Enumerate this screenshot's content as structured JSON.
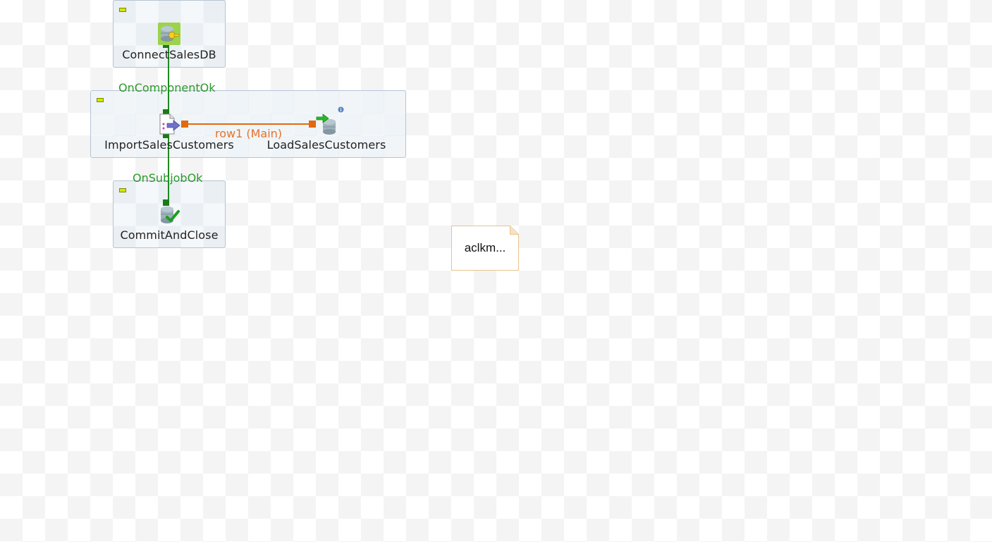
{
  "job": {
    "subjobs": [
      {
        "components": [
          {
            "label": "ConnectSalesDB",
            "icon": "database-connect-icon"
          }
        ]
      },
      {
        "components": [
          {
            "label": "ImportSalesCustomers",
            "icon": "file-input-icon"
          },
          {
            "label": "LoadSalesCustomers",
            "icon": "database-output-icon"
          }
        ]
      },
      {
        "components": [
          {
            "label": "CommitAndClose",
            "icon": "database-commit-icon"
          }
        ]
      }
    ],
    "links": [
      {
        "label": "OnComponentOk",
        "color": "#2a9a2a"
      },
      {
        "label": "row1 (Main)",
        "color": "#e3742c"
      },
      {
        "label": "OnSubjobOk",
        "color": "#2a9a2a"
      }
    ],
    "note": {
      "text": "aclkm..."
    }
  },
  "colors": {
    "trigger_link": "#1f8a1f",
    "main_link": "#e06a10",
    "note_border": "#e8c48c"
  }
}
